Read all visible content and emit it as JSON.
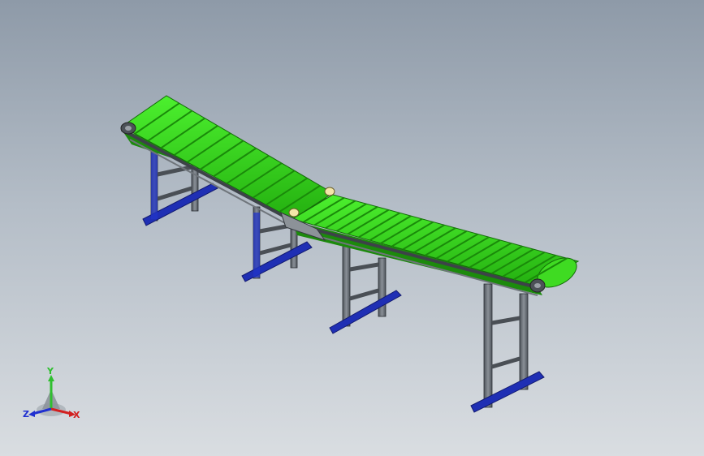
{
  "viewport": {
    "background_top": "#8e9aa8",
    "background_bottom": "#d9dde1"
  },
  "model": {
    "description_type": "3D CAD isometric view",
    "belt_color": "#37e61f",
    "belt_dark_color": "#1fa80f",
    "frame_color": "#5b6168",
    "foot_color": "#1f2fb4"
  },
  "triad": {
    "y_label": "Y",
    "x_label": "X",
    "z_label": "Z",
    "y_color": "#2fbf2f",
    "x_color": "#d22020",
    "z_color": "#2030d0"
  }
}
